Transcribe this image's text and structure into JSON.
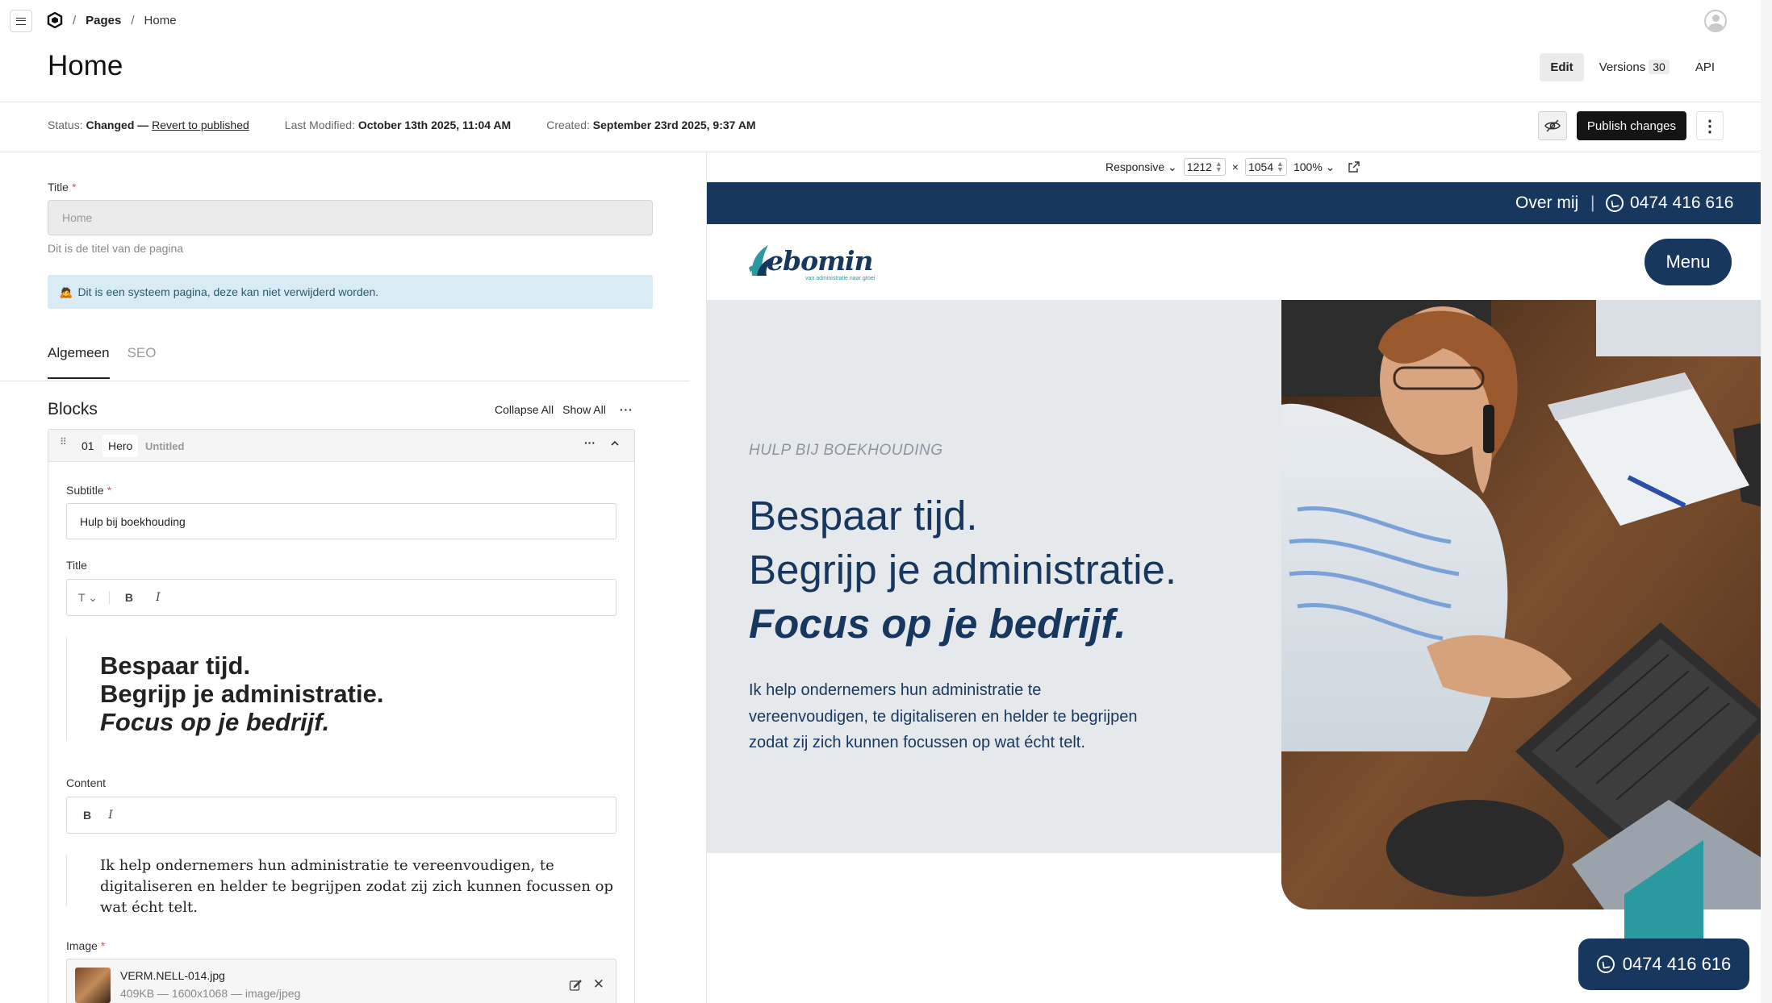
{
  "breadcrumb": {
    "separator": "/",
    "section": "Pages",
    "current": "Home"
  },
  "page": {
    "title": "Home"
  },
  "header_actions": {
    "edit": "Edit",
    "versions": "Versions",
    "versions_count": "30",
    "api": "API"
  },
  "status": {
    "status_label": "Status:",
    "status_value": "Changed",
    "dash": "—",
    "revert_link": "Revert to published",
    "modified_label": "Last Modified:",
    "modified_value": "October 13th 2025, 11:04 AM",
    "created_label": "Created:",
    "created_value": "September 23rd 2025, 9:37 AM",
    "publish_button": "Publish changes"
  },
  "form": {
    "title_label": "Title",
    "title_required": "*",
    "title_value": "Home",
    "title_hint": "Dit is de titel van de pagina",
    "alert_emoji": "🙇",
    "alert_text": "Dit is een systeem pagina, deze kan niet verwijderd worden.",
    "tabs": [
      {
        "label": "Algemeen"
      },
      {
        "label": "SEO"
      }
    ]
  },
  "blocks": {
    "title": "Blocks",
    "collapse_all": "Collapse All",
    "show_all": "Show All",
    "more": "···",
    "block": {
      "number": "01",
      "type": "Hero",
      "name": "Untitled",
      "subtitle_label": "Subtitle",
      "subtitle_value": "Hulp bij boekhouding",
      "title_label": "Title",
      "title_lines": [
        "Bespaar tijd.",
        "Begrijp je administratie.",
        "Focus op je bedrijf."
      ],
      "content_label": "Content",
      "content_text": "Ik help ondernemers hun administratie te vereenvoudigen, te digitaliseren en helder te begrijpen zodat zij zich kunnen focussen op wat écht telt.",
      "image_label": "Image",
      "image_name": "VERM.NELL-014.jpg",
      "image_meta": "409KB — 1600x1068 — image/jpeg",
      "toolbar_text_style": "T",
      "toolbar_bold": "B",
      "toolbar_italic": "I"
    }
  },
  "preview": {
    "viewport_mode": "Responsive",
    "width": "1212",
    "height": "1054",
    "times": "×",
    "zoom": "100%"
  },
  "site": {
    "topbar_link": "Over mij",
    "topbar_sep": "|",
    "phone": "0474 416 616",
    "logo_word": "ebomin",
    "logo_tagline": "van administratie naar groei",
    "menu_button": "Menu",
    "hero_subtitle": "HULP BIJ BOEKHOUDING",
    "hero_lines": [
      "Bespaar tijd.",
      "Begrijp je administratie.",
      "Focus op je bedrijf."
    ],
    "hero_text": "Ik help ondernemers hun administratie te vereenvoudigen, te digitaliseren en helder te begrijpen zodat zij zich kunnen focussen op wat écht telt.",
    "float_phone": "0474 416 616"
  },
  "colors": {
    "navy": "#17375e",
    "teal": "#2a9aa0",
    "hero_bg": "#e6e9ec",
    "alert_bg": "#d9ecf5",
    "publish_bg": "#141414"
  }
}
